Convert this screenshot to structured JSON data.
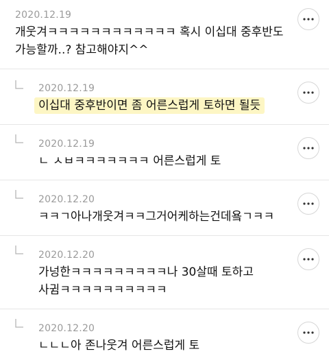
{
  "comments": [
    {
      "date": "2020.12.19",
      "lines": [
        "개웃겨ㅋㅋㅋㅋㅋㅋㅋㅋㅋㅋㅋㅋ 혹시 이십대 중후반도",
        "가능할까..? 참고해야지^^"
      ],
      "is_reply": false
    },
    {
      "date": "2020.12.19",
      "lines": [
        "이십대 중후반이면 좀 어른스럽게 토하면 될듯"
      ],
      "is_reply": true,
      "highlighted": true
    },
    {
      "date": "2020.12.19",
      "lines": [
        "ㄴ ㅅㅂㅋㅋㅋㅋㅋㅋㅋ 어른스럽게 토"
      ],
      "is_reply": true
    },
    {
      "date": "2020.12.20",
      "lines": [
        "ㅋㅋㄱ아나개웃겨ㅋㅋ그거어케하는건데욬ㄱㅋㅋ"
      ],
      "is_reply": true
    },
    {
      "date": "2020.12.20",
      "lines": [
        "가넝한ㅋㅋㅋㅋㅋㅋㅋㅋㅋ나 30살때 토하고",
        "사귐ㅋㅋㅋㅋㅋㅋㅋㅋㅋㅋ"
      ],
      "is_reply": true
    },
    {
      "date": "2020.12.20",
      "lines": [
        "ㄴㄴㄴ아 존나웃겨 어른스럽게 토"
      ],
      "is_reply": true
    }
  ],
  "icons": {
    "more": "more-options-icon",
    "reply": "reply-arrow-icon"
  },
  "colors": {
    "highlight": "#fdf6c4",
    "date": "#9a9a9a",
    "divider": "#e6e6e6"
  }
}
